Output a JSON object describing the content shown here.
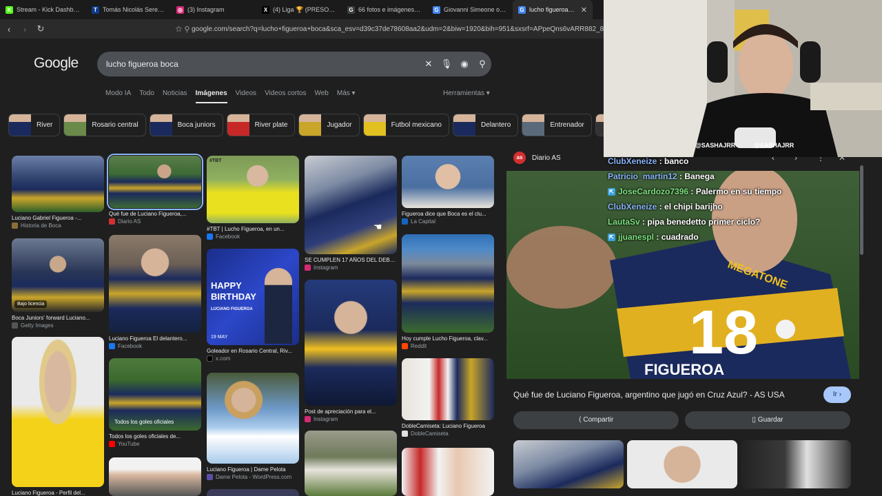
{
  "tabs": [
    {
      "label": "Stream - Kick Dashboard",
      "fav": "K",
      "color": "#53fc18",
      "active": false
    },
    {
      "label": "Tomás Nicolás Sereda - P",
      "fav": "T",
      "color": "#0d3b8a",
      "active": false
    },
    {
      "label": "(3) Instagram",
      "fav": "◎",
      "color": "#d62976",
      "active": false
    },
    {
      "label": "(4) Liga 🏆 (PRESO POLÍT",
      "fav": "X",
      "color": "#000000",
      "active": false
    },
    {
      "label": "66 fotos e imágenes de a",
      "fav": "G",
      "color": "#3c4043",
      "active": false
    },
    {
      "label": "Giovanni Simeone of Tori",
      "fav": "G",
      "color": "#4285f4",
      "active": false
    },
    {
      "label": "lucho figueroa boca",
      "fav": "G",
      "color": "#4285f4",
      "active": true
    }
  ],
  "url": "google.com/search?q=lucho+figueroa+boca&sca_esv=d39c37de78608aa2&udm=2&biw=1920&bih=951&sxsrf=APpeQns6vARR882_8sD4",
  "google": {
    "logo": "Google",
    "query": "lucho figueroa boca",
    "nav": [
      "Modo IA",
      "Todo",
      "Noticias",
      "Imágenes",
      "Videos",
      "Videos cortos",
      "Web",
      "Más ▾"
    ],
    "active_nav": "Imágenes",
    "tools": "Herramientas ▾"
  },
  "chips": [
    "River",
    "Rosario central",
    "Boca juniors",
    "River plate",
    "Jugador",
    "Futbol mexicano",
    "Delantero",
    "Entrenador"
  ],
  "cards": [
    {
      "caption": "Luciano Gabriel Figueroa -...",
      "source": "Historia de Boca"
    },
    {
      "caption": "Boca Juniors' forward Luciano...",
      "source": "Getty Images",
      "license": "Bajo licencia"
    },
    {
      "caption": "Luciano Figueroa - Perfil del...",
      "source": ""
    },
    {
      "caption": "Qué fue de Luciano Figueroa,...",
      "source": "Diario AS"
    },
    {
      "caption": "Luciano Figueroa El delantero...",
      "source": "Facebook"
    },
    {
      "caption": "Todos los goles oficiales de...",
      "source": "YouTube"
    },
    {
      "caption": "#TBT | Lucho Figueroa, en un...",
      "source": "Facebook"
    },
    {
      "caption": "Goleador en Rosario Central, Riv...",
      "source": "x.com"
    },
    {
      "caption": "Luciano Figueroa | Dame Pelota",
      "source": "Dame Pelota - WordPress.com"
    },
    {
      "caption": "SE CUMPLEN 17 AÑOS DEL DEBU...",
      "source": "Instagram"
    },
    {
      "caption": "Post de apreciación para el...",
      "source": "Instagram"
    },
    {
      "caption": "Figueroa dice que Boca es el clu...",
      "source": "La Capital"
    },
    {
      "caption": "Hoy cumple Lucho Figueroa, clav...",
      "source": "Reddit"
    },
    {
      "caption": "DobleCamiseta: Luciano Figueroa",
      "source": "DobleCamiseta"
    }
  ],
  "poster": {
    "happy": "HAPPY",
    "birthday": "BIRTHDAY",
    "name": "LUCIANO FIGUEROA",
    "date": "19 MAY"
  },
  "thumb_text": {
    "tbt": "#TBT",
    "goles": "Todos los goles oficiales"
  },
  "preview": {
    "source": "Diario AS",
    "fav": "as",
    "title": "Qué fue de Luciano Figueroa, argentino que jugó en Cruz Azul? - AS USA",
    "go": "Ir ›",
    "share": "⟨ Compartir",
    "save": "▯ Guardar",
    "jersey_number": "18",
    "jersey_name": "FIGUEROA",
    "sponsor": "MEGATONE"
  },
  "webcam": {
    "handle1": "@SASHAJRR",
    "handle2": "@SASHAJRR"
  },
  "chat": [
    {
      "user": "ClubXeneize",
      "color": "#8ab4f8",
      "msg": "banco",
      "badge": false
    },
    {
      "user": "Patricio_martin12",
      "color": "#8ab4f8",
      "msg": "Banega",
      "badge": false
    },
    {
      "user": "JoseCardozo7396",
      "color": "#7ee081",
      "msg": "Palermo en su tiempo",
      "badge": true
    },
    {
      "user": "ClubXeneize",
      "color": "#8ab4f8",
      "msg": "el chipi barijho",
      "badge": false
    },
    {
      "user": "LautaSv",
      "color": "#7ee081",
      "msg": "pipa benedetto primer ciclo?",
      "badge": false
    },
    {
      "user": "jjuanespl",
      "color": "#7ee081",
      "msg": "cuadrado",
      "badge": true
    }
  ],
  "colors": {
    "accent": "#8ab4f8",
    "bg": "#1f1f1f",
    "boca_blue": "#1b2a5c",
    "boca_gold": "#f0c020"
  }
}
